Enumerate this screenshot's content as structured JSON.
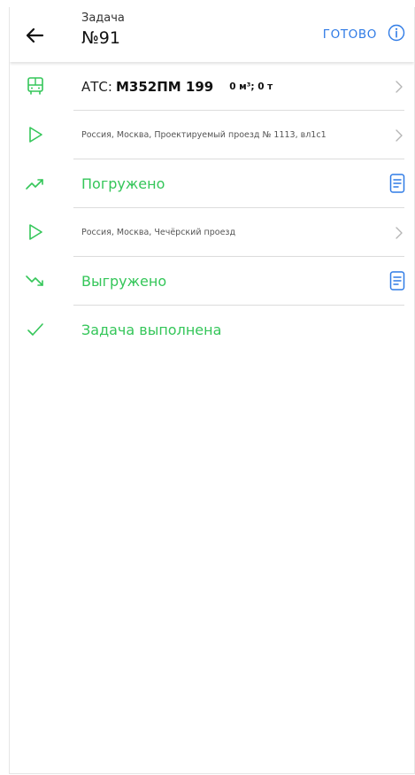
{
  "header": {
    "subtitle": "Задача",
    "title": "№91",
    "done_label": "ГОТОВО"
  },
  "rows": {
    "vehicle": {
      "label": "АТС:",
      "plate": "М352ПМ 199",
      "volume": "0 м³; 0 т"
    },
    "route1": {
      "address": "Россия, Москва, Проектируемый проезд № 1113, вл1с1"
    },
    "loaded": {
      "label": "Погружено"
    },
    "route2": {
      "address": "Россия, Москва, Чечёрский проезд"
    },
    "unloaded": {
      "label": "Выгружено"
    },
    "completed": {
      "label": "Задача выполнена"
    }
  },
  "colors": {
    "accent_green": "#34c659",
    "link_blue": "#2f7be6"
  },
  "icons": [
    "back-arrow-icon",
    "info-icon",
    "bus-icon",
    "play-icon",
    "trend-up-icon",
    "document-icon",
    "trend-down-icon",
    "check-icon",
    "chevron-right-icon"
  ]
}
